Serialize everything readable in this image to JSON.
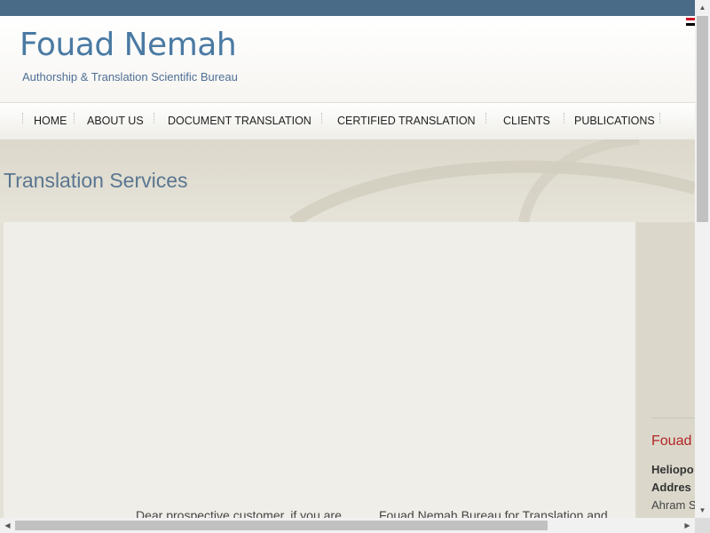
{
  "brand": {
    "title": "Fouad Nemah",
    "subtitle": "Authorship & Translation Scientific Bureau"
  },
  "nav": {
    "items": [
      {
        "label": "HOME"
      },
      {
        "label": "ABOUT US"
      },
      {
        "label": "DOCUMENT TRANSLATION"
      },
      {
        "label": "CERTIFIED TRANSLATION"
      },
      {
        "label": "CLIENTS"
      },
      {
        "label": "PUBLICATIONS"
      }
    ]
  },
  "page": {
    "heading": "Translation Services"
  },
  "main": {
    "col1_text": "Dear prospective customer, if you are",
    "col2_text": "Fouad Nemah Bureau for Translation and"
  },
  "sidebar": {
    "title_partial": "Fouad",
    "line1": "Heliopo",
    "line2": "Addres",
    "line3": "Ahram S"
  },
  "colors": {
    "topbar": "#4a6b87",
    "brand_blue": "#4a7aa3",
    "accent_red": "#b22424",
    "heading": "#5a7690"
  },
  "scrollbars": {
    "up_icon": "▲",
    "down_icon": "▼",
    "left_icon": "◀",
    "right_icon": "▶"
  }
}
